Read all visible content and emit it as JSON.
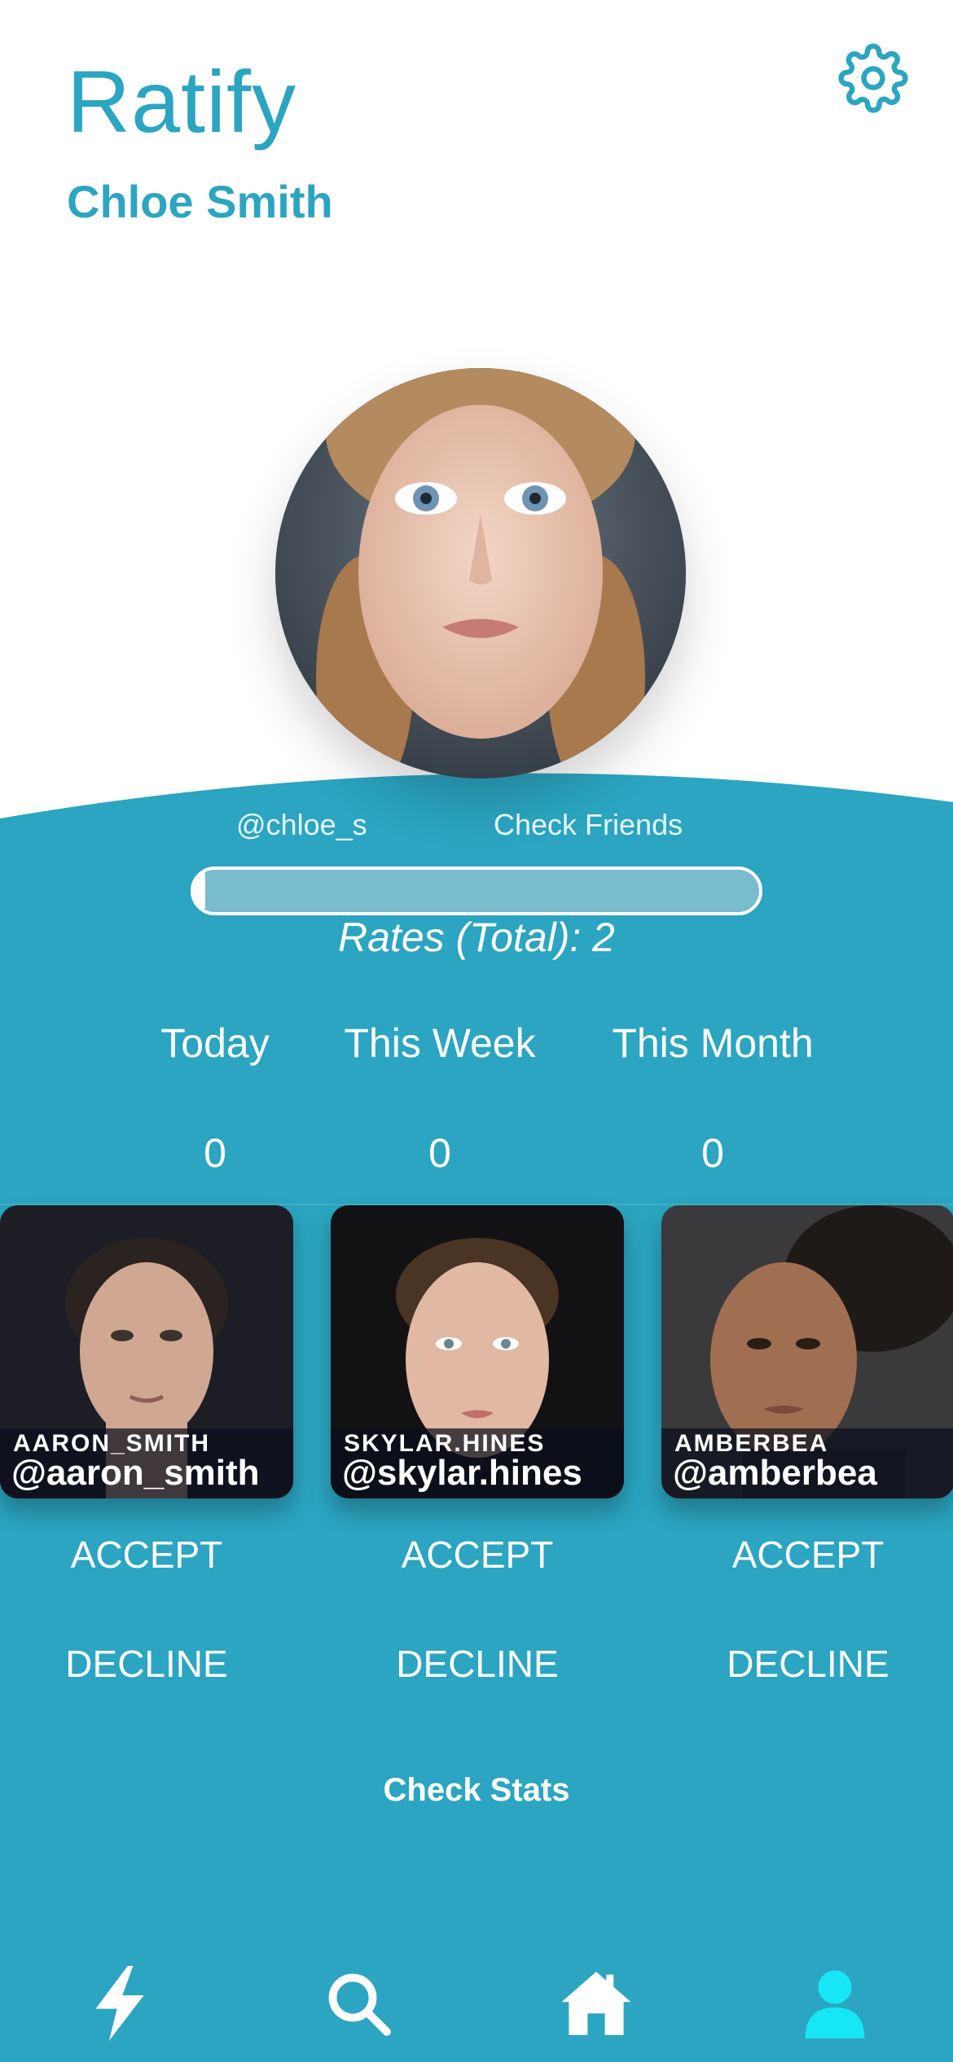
{
  "header": {
    "app_title": "Ratify",
    "user_name": "Chloe Smith",
    "settings_icon": "gear-icon"
  },
  "profile": {
    "handle": "@chloe_s",
    "check_friends_label": "Check Friends",
    "progress_fraction": 0.02,
    "rates_total_label": "Rates (Total): 2"
  },
  "stats": {
    "periods": [
      {
        "label": "Today",
        "value": "0"
      },
      {
        "label": "This Week",
        "value": "0"
      },
      {
        "label": "This Month",
        "value": "0"
      }
    ]
  },
  "requests": [
    {
      "username": "AARON_SMITH",
      "handle": "@aaron_smith",
      "accept_label": "ACCEPT",
      "decline_label": "DECLINE"
    },
    {
      "username": "SKYLAR.HINES",
      "handle": "@skylar.hines",
      "accept_label": "ACCEPT",
      "decline_label": "DECLINE"
    },
    {
      "username": "AMBERBEA",
      "handle": "@amberbea",
      "accept_label": "ACCEPT",
      "decline_label": "DECLINE"
    }
  ],
  "check_stats_label": "Check Stats",
  "nav": {
    "items": [
      {
        "icon": "lightning-icon",
        "active": false
      },
      {
        "icon": "search-icon",
        "active": false
      },
      {
        "icon": "home-icon",
        "active": false
      },
      {
        "icon": "profile-icon",
        "active": true
      }
    ]
  },
  "colors": {
    "accent": "#2ba5c1",
    "nav_inactive": "#ffffff",
    "nav_active": "#17e6f5"
  }
}
